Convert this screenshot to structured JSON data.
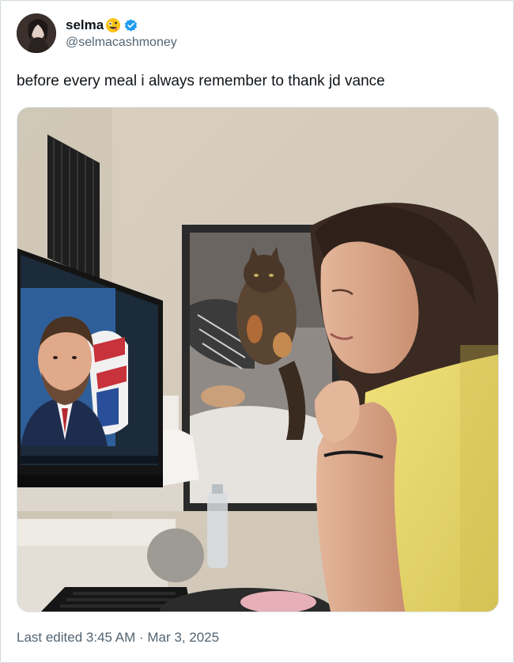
{
  "post": {
    "author": {
      "display_name": "selma",
      "handle": "@selmacashmoney",
      "emoji_icon": "zany-face-emoji",
      "verified_icon": "verified-badge-icon",
      "verified_color": "#1d9bf0"
    },
    "text": "before every meal i always remember to thank jd vance",
    "media": {
      "type": "photo"
    },
    "footer": {
      "edited_label": "Last edited 3:45 AM · Mar 3, 2025"
    }
  },
  "colors": {
    "text_primary": "#0f1419",
    "text_secondary": "#536471",
    "border": "#cfd9de",
    "shirt": "#e8d86a"
  }
}
